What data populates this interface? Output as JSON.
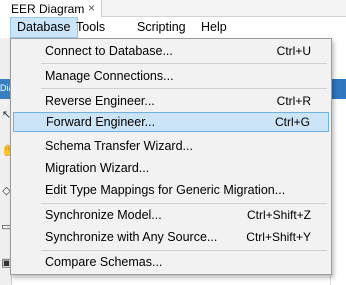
{
  "tab": {
    "title": "EER Diagram",
    "close": "×"
  },
  "menubar": {
    "items": [
      {
        "label": "Database"
      },
      {
        "label": "Tools"
      },
      {
        "label": "Scripting"
      },
      {
        "label": "Help"
      }
    ]
  },
  "left_panel_label": "Dia",
  "dropdown": {
    "items": [
      {
        "label": "Connect to Database...",
        "shortcut": "Ctrl+U"
      },
      {
        "label": "Manage Connections...",
        "shortcut": ""
      },
      {
        "label": "Reverse Engineer...",
        "shortcut": "Ctrl+R"
      },
      {
        "label": "Forward Engineer...",
        "shortcut": "Ctrl+G"
      },
      {
        "label": "Schema Transfer Wizard...",
        "shortcut": ""
      },
      {
        "label": "Migration Wizard...",
        "shortcut": ""
      },
      {
        "label": "Edit Type Mappings for Generic Migration...",
        "shortcut": ""
      },
      {
        "label": "Synchronize Model...",
        "shortcut": "Ctrl+Shift+Z"
      },
      {
        "label": "Synchronize with Any Source...",
        "shortcut": "Ctrl+Shift+Y"
      },
      {
        "label": "Compare Schemas...",
        "shortcut": ""
      }
    ],
    "highlighted": "Forward Engineer..."
  },
  "colors": {
    "highlight_bg": "#cce4f7",
    "highlight_border": "#6fb0e6",
    "menu_bg": "#f2f2f2"
  }
}
